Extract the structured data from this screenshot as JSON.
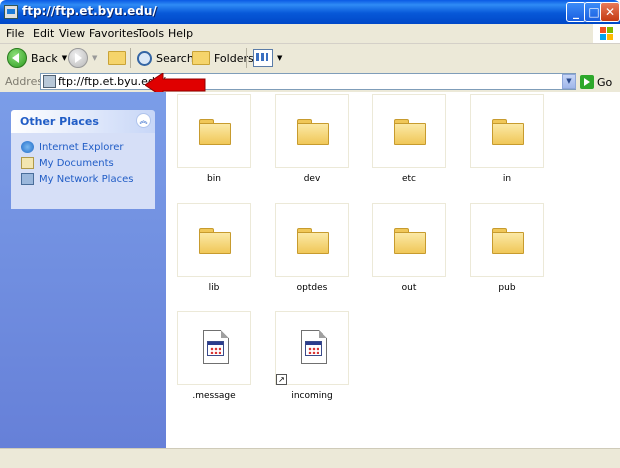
{
  "window": {
    "title": "ftp://ftp.et.byu.edu/",
    "minimize_label": "_",
    "maximize_label": "□",
    "close_label": "✕"
  },
  "menu": [
    "File",
    "Edit",
    "View",
    "Favorites",
    "Tools",
    "Help"
  ],
  "toolbar": {
    "back_label": "Back",
    "search_label": "Search",
    "folders_label": "Folders"
  },
  "address": {
    "label": "Address",
    "value": "ftp://ftp.et.byu.edu/",
    "go_label": "Go"
  },
  "sidebar": {
    "other_places_title": "Other Places",
    "links": [
      "Internet Explorer",
      "My Documents",
      "My Network Places"
    ]
  },
  "files": [
    {
      "name": "bin",
      "type": "folder"
    },
    {
      "name": "dev",
      "type": "folder"
    },
    {
      "name": "etc",
      "type": "folder"
    },
    {
      "name": "in",
      "type": "folder"
    },
    {
      "name": "lib",
      "type": "folder"
    },
    {
      "name": "optdes",
      "type": "folder"
    },
    {
      "name": "out",
      "type": "folder"
    },
    {
      "name": "pub",
      "type": "folder"
    },
    {
      "name": ".message",
      "type": "file"
    },
    {
      "name": "incoming",
      "type": "shortcut"
    }
  ],
  "colors": {
    "titlebar": "#0a5ae4",
    "sidebar": "#7b9de8",
    "link": "#215dc6",
    "arrow": "#e00000"
  }
}
